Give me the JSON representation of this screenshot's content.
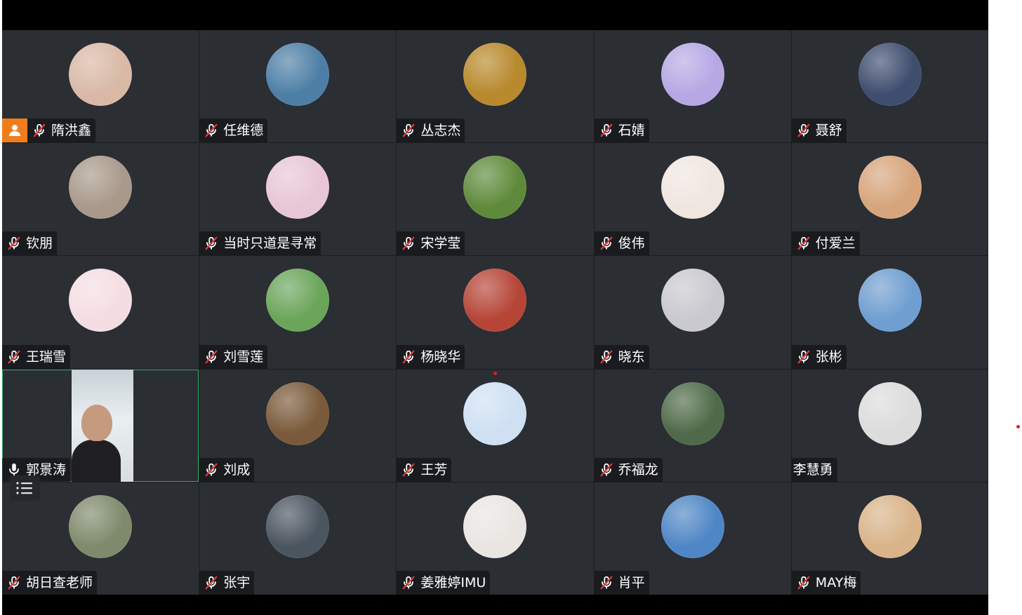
{
  "colors": {
    "tile_bg": "#2b2e33",
    "host_badge": "#f07d1d",
    "active_border": "#2fb36a"
  },
  "participants": [
    {
      "name": "隋洪鑫",
      "host": true,
      "mic": "muted",
      "avatar": "#d9b9a6"
    },
    {
      "name": "任维德",
      "mic": "muted",
      "avatar": "#4d7fa6"
    },
    {
      "name": "丛志杰",
      "mic": "muted",
      "avatar": "#b8892d"
    },
    {
      "name": "石婧",
      "mic": "muted",
      "avatar": "#b7a8e4"
    },
    {
      "name": "聂舒",
      "mic": "muted",
      "avatar": "#3f4e6f"
    },
    {
      "name": "钦朋",
      "mic": "muted",
      "avatar": "#a8998a"
    },
    {
      "name": "当时只道是寻常",
      "mic": "muted",
      "avatar": "#e8c6d6"
    },
    {
      "name": "宋学莹",
      "mic": "muted",
      "avatar": "#5f8a3b"
    },
    {
      "name": "俊伟",
      "mic": "muted",
      "avatar": "#f0e6e0"
    },
    {
      "name": "付爱兰",
      "mic": "muted",
      "avatar": "#d7a57c"
    },
    {
      "name": "王瑞雪",
      "mic": "muted",
      "avatar": "#f4dde3"
    },
    {
      "name": "刘雪莲",
      "mic": "muted",
      "avatar": "#6aa55a"
    },
    {
      "name": "杨晓华",
      "mic": "muted",
      "avatar": "#b64538"
    },
    {
      "name": "晓东",
      "mic": "muted",
      "avatar": "#c9c9cf"
    },
    {
      "name": "张彬",
      "mic": "muted",
      "avatar": "#6f9ed0"
    },
    {
      "name": "郭景涛",
      "mic": "on",
      "video": true,
      "active": true
    },
    {
      "name": "刘成",
      "mic": "muted",
      "avatar": "#7a5a3a"
    },
    {
      "name": "王芳",
      "mic": "muted",
      "avatar": "#cfe0f3"
    },
    {
      "name": "乔福龙",
      "mic": "muted",
      "avatar": "#4f6a48"
    },
    {
      "name": "李慧勇",
      "mic": "none",
      "avatar": "#dcdcdc"
    },
    {
      "name": "胡日查老师",
      "mic": "muted",
      "avatar": "#7f8a6c"
    },
    {
      "name": "张宇",
      "mic": "muted",
      "avatar": "#4b5560"
    },
    {
      "name": "姜雅婷IMU",
      "mic": "muted",
      "avatar": "#e9e6e2"
    },
    {
      "name": "肖平",
      "mic": "muted",
      "avatar": "#4f86c6"
    },
    {
      "name": "MAY梅",
      "mic": "muted",
      "avatar": "#d9b48a"
    }
  ]
}
